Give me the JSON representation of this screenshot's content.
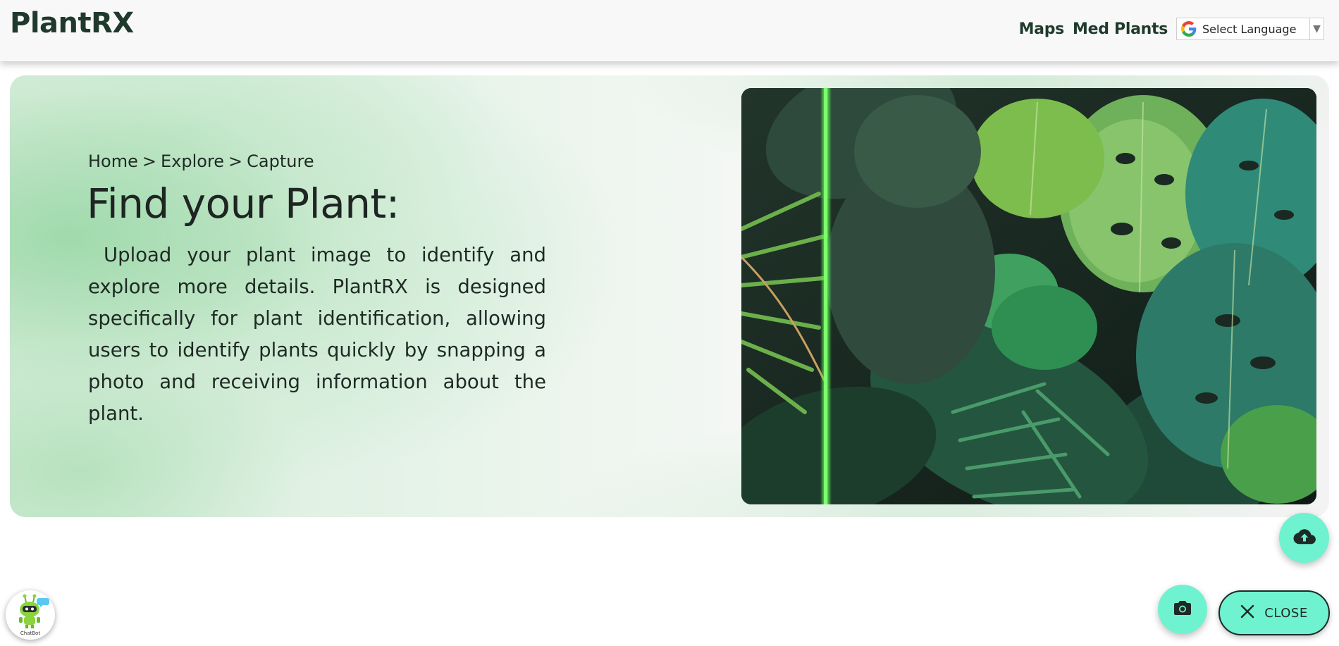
{
  "header": {
    "brand": "PlantRX",
    "nav": {
      "maps": "Maps",
      "med_plants": "Med Plants"
    },
    "language_select": {
      "label": "Select Language",
      "icon": "google-g-icon"
    }
  },
  "hero": {
    "breadcrumb": [
      "Home",
      "Explore",
      "Capture"
    ],
    "breadcrumb_separator": ">",
    "title": "Find your Plant:",
    "description": "Upload your plant image to identify and explore more details. PlantRX is designed specifically for plant identification, allowing users to identify plants quickly by snapping a photo and receiving information about the plant.",
    "image_alt": "tropical leaves"
  },
  "actions": {
    "upload_icon": "cloud-upload-icon",
    "camera_icon": "camera-icon",
    "close_label": "CLOSE",
    "close_icon": "close-icon",
    "chatbot_label": "ChatBot"
  },
  "colors": {
    "accent": "#6ff2cf",
    "brand_text": "#1f3a2c",
    "scan_line": "#5df05a"
  }
}
